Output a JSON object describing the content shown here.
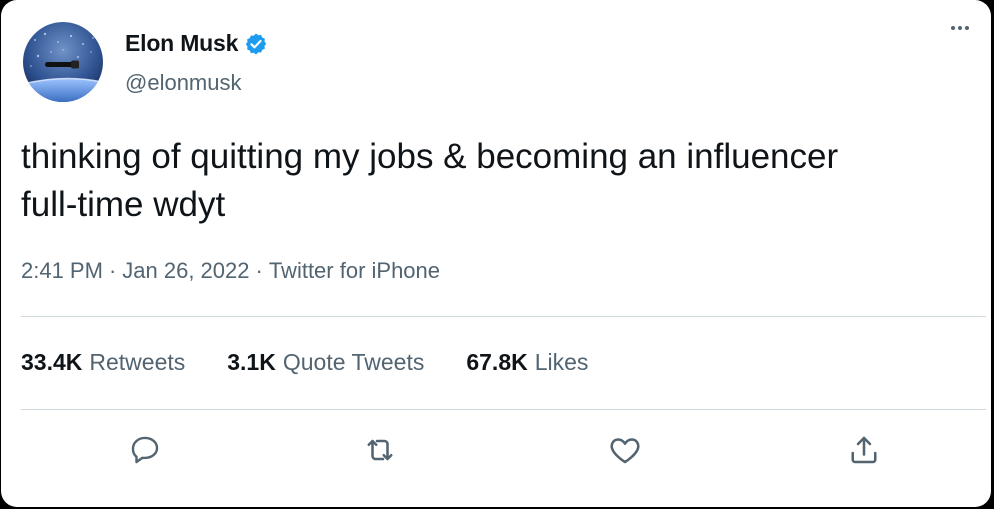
{
  "tweet": {
    "author": {
      "name": "Elon Musk",
      "handle": "@elonmusk",
      "avatar_icon": "space-ship-avatar",
      "verified_icon": "verified-badge-icon"
    },
    "text": "thinking of quitting my jobs & becoming an influencer\nfull-time wdyt",
    "meta": {
      "time": "2:41 PM",
      "separator1": "·",
      "date": "Jan 26, 2022",
      "separator2": "·",
      "source": "Twitter for iPhone"
    },
    "stats": [
      {
        "count": "33.4K",
        "label": "Retweets"
      },
      {
        "count": "3.1K",
        "label": "Quote Tweets"
      },
      {
        "count": "67.8K",
        "label": "Likes"
      }
    ],
    "actions": [
      "reply-icon",
      "retweet-icon",
      "like-icon",
      "share-icon"
    ]
  },
  "colors": {
    "text_primary": "#0f1419",
    "text_secondary": "#536471",
    "divider": "#cfd9de",
    "verified": "#1d9bf0",
    "background": "#ffffff",
    "frame": "#000000"
  }
}
